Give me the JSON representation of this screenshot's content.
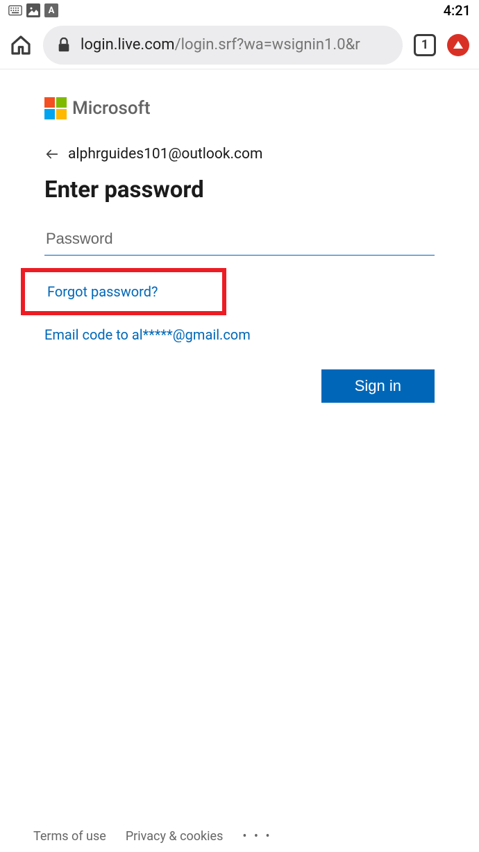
{
  "status_bar": {
    "time": "4:21"
  },
  "browser": {
    "url_host": "login.live.com",
    "url_path": "/login.srf?wa=wsignin1.0&r",
    "tab_count": "1"
  },
  "logo": {
    "brand": "Microsoft"
  },
  "account": {
    "email": "alphrguides101@outlook.com"
  },
  "page": {
    "title": "Enter password"
  },
  "password": {
    "placeholder": "Password",
    "value": ""
  },
  "links": {
    "forgot": "Forgot password?",
    "email_code": "Email code to al*****@gmail.com"
  },
  "buttons": {
    "signin": "Sign in"
  },
  "footer": {
    "terms": "Terms of use",
    "privacy": "Privacy & cookies"
  }
}
